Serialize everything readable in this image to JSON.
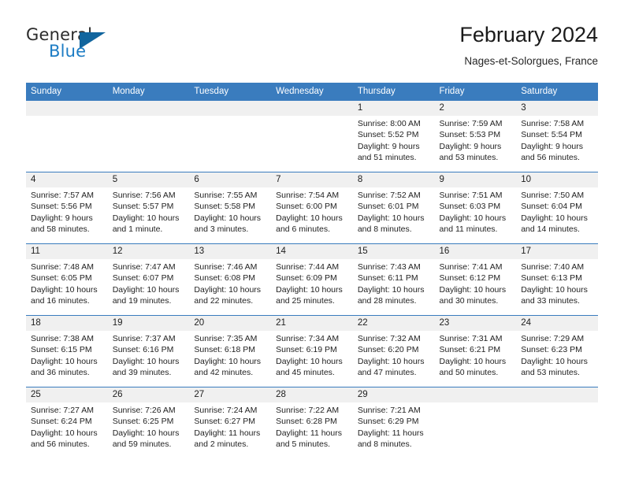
{
  "brand": {
    "name_top": "General",
    "name_bottom": "Blue",
    "triangle_color": "#11659e",
    "blue_text_color": "#1c7cc4"
  },
  "header": {
    "title": "February 2024",
    "subtitle": "Nages-et-Solorgues, France"
  },
  "theme": {
    "header_blue": "#3a7cbe",
    "daynum_band": "#f0f0f0",
    "text": "#1f1f1f"
  },
  "weekdays": [
    "Sunday",
    "Monday",
    "Tuesday",
    "Wednesday",
    "Thursday",
    "Friday",
    "Saturday"
  ],
  "weeks": [
    {
      "days": [
        {
          "num": "",
          "sunrise": "",
          "sunset": "",
          "daylight1": "",
          "daylight2": ""
        },
        {
          "num": "",
          "sunrise": "",
          "sunset": "",
          "daylight1": "",
          "daylight2": ""
        },
        {
          "num": "",
          "sunrise": "",
          "sunset": "",
          "daylight1": "",
          "daylight2": ""
        },
        {
          "num": "",
          "sunrise": "",
          "sunset": "",
          "daylight1": "",
          "daylight2": ""
        },
        {
          "num": "1",
          "sunrise": "Sunrise: 8:00 AM",
          "sunset": "Sunset: 5:52 PM",
          "daylight1": "Daylight: 9 hours",
          "daylight2": "and 51 minutes."
        },
        {
          "num": "2",
          "sunrise": "Sunrise: 7:59 AM",
          "sunset": "Sunset: 5:53 PM",
          "daylight1": "Daylight: 9 hours",
          "daylight2": "and 53 minutes."
        },
        {
          "num": "3",
          "sunrise": "Sunrise: 7:58 AM",
          "sunset": "Sunset: 5:54 PM",
          "daylight1": "Daylight: 9 hours",
          "daylight2": "and 56 minutes."
        }
      ]
    },
    {
      "days": [
        {
          "num": "4",
          "sunrise": "Sunrise: 7:57 AM",
          "sunset": "Sunset: 5:56 PM",
          "daylight1": "Daylight: 9 hours",
          "daylight2": "and 58 minutes."
        },
        {
          "num": "5",
          "sunrise": "Sunrise: 7:56 AM",
          "sunset": "Sunset: 5:57 PM",
          "daylight1": "Daylight: 10 hours",
          "daylight2": "and 1 minute."
        },
        {
          "num": "6",
          "sunrise": "Sunrise: 7:55 AM",
          "sunset": "Sunset: 5:58 PM",
          "daylight1": "Daylight: 10 hours",
          "daylight2": "and 3 minutes."
        },
        {
          "num": "7",
          "sunrise": "Sunrise: 7:54 AM",
          "sunset": "Sunset: 6:00 PM",
          "daylight1": "Daylight: 10 hours",
          "daylight2": "and 6 minutes."
        },
        {
          "num": "8",
          "sunrise": "Sunrise: 7:52 AM",
          "sunset": "Sunset: 6:01 PM",
          "daylight1": "Daylight: 10 hours",
          "daylight2": "and 8 minutes."
        },
        {
          "num": "9",
          "sunrise": "Sunrise: 7:51 AM",
          "sunset": "Sunset: 6:03 PM",
          "daylight1": "Daylight: 10 hours",
          "daylight2": "and 11 minutes."
        },
        {
          "num": "10",
          "sunrise": "Sunrise: 7:50 AM",
          "sunset": "Sunset: 6:04 PM",
          "daylight1": "Daylight: 10 hours",
          "daylight2": "and 14 minutes."
        }
      ]
    },
    {
      "days": [
        {
          "num": "11",
          "sunrise": "Sunrise: 7:48 AM",
          "sunset": "Sunset: 6:05 PM",
          "daylight1": "Daylight: 10 hours",
          "daylight2": "and 16 minutes."
        },
        {
          "num": "12",
          "sunrise": "Sunrise: 7:47 AM",
          "sunset": "Sunset: 6:07 PM",
          "daylight1": "Daylight: 10 hours",
          "daylight2": "and 19 minutes."
        },
        {
          "num": "13",
          "sunrise": "Sunrise: 7:46 AM",
          "sunset": "Sunset: 6:08 PM",
          "daylight1": "Daylight: 10 hours",
          "daylight2": "and 22 minutes."
        },
        {
          "num": "14",
          "sunrise": "Sunrise: 7:44 AM",
          "sunset": "Sunset: 6:09 PM",
          "daylight1": "Daylight: 10 hours",
          "daylight2": "and 25 minutes."
        },
        {
          "num": "15",
          "sunrise": "Sunrise: 7:43 AM",
          "sunset": "Sunset: 6:11 PM",
          "daylight1": "Daylight: 10 hours",
          "daylight2": "and 28 minutes."
        },
        {
          "num": "16",
          "sunrise": "Sunrise: 7:41 AM",
          "sunset": "Sunset: 6:12 PM",
          "daylight1": "Daylight: 10 hours",
          "daylight2": "and 30 minutes."
        },
        {
          "num": "17",
          "sunrise": "Sunrise: 7:40 AM",
          "sunset": "Sunset: 6:13 PM",
          "daylight1": "Daylight: 10 hours",
          "daylight2": "and 33 minutes."
        }
      ]
    },
    {
      "days": [
        {
          "num": "18",
          "sunrise": "Sunrise: 7:38 AM",
          "sunset": "Sunset: 6:15 PM",
          "daylight1": "Daylight: 10 hours",
          "daylight2": "and 36 minutes."
        },
        {
          "num": "19",
          "sunrise": "Sunrise: 7:37 AM",
          "sunset": "Sunset: 6:16 PM",
          "daylight1": "Daylight: 10 hours",
          "daylight2": "and 39 minutes."
        },
        {
          "num": "20",
          "sunrise": "Sunrise: 7:35 AM",
          "sunset": "Sunset: 6:18 PM",
          "daylight1": "Daylight: 10 hours",
          "daylight2": "and 42 minutes."
        },
        {
          "num": "21",
          "sunrise": "Sunrise: 7:34 AM",
          "sunset": "Sunset: 6:19 PM",
          "daylight1": "Daylight: 10 hours",
          "daylight2": "and 45 minutes."
        },
        {
          "num": "22",
          "sunrise": "Sunrise: 7:32 AM",
          "sunset": "Sunset: 6:20 PM",
          "daylight1": "Daylight: 10 hours",
          "daylight2": "and 47 minutes."
        },
        {
          "num": "23",
          "sunrise": "Sunrise: 7:31 AM",
          "sunset": "Sunset: 6:21 PM",
          "daylight1": "Daylight: 10 hours",
          "daylight2": "and 50 minutes."
        },
        {
          "num": "24",
          "sunrise": "Sunrise: 7:29 AM",
          "sunset": "Sunset: 6:23 PM",
          "daylight1": "Daylight: 10 hours",
          "daylight2": "and 53 minutes."
        }
      ]
    },
    {
      "days": [
        {
          "num": "25",
          "sunrise": "Sunrise: 7:27 AM",
          "sunset": "Sunset: 6:24 PM",
          "daylight1": "Daylight: 10 hours",
          "daylight2": "and 56 minutes."
        },
        {
          "num": "26",
          "sunrise": "Sunrise: 7:26 AM",
          "sunset": "Sunset: 6:25 PM",
          "daylight1": "Daylight: 10 hours",
          "daylight2": "and 59 minutes."
        },
        {
          "num": "27",
          "sunrise": "Sunrise: 7:24 AM",
          "sunset": "Sunset: 6:27 PM",
          "daylight1": "Daylight: 11 hours",
          "daylight2": "and 2 minutes."
        },
        {
          "num": "28",
          "sunrise": "Sunrise: 7:22 AM",
          "sunset": "Sunset: 6:28 PM",
          "daylight1": "Daylight: 11 hours",
          "daylight2": "and 5 minutes."
        },
        {
          "num": "29",
          "sunrise": "Sunrise: 7:21 AM",
          "sunset": "Sunset: 6:29 PM",
          "daylight1": "Daylight: 11 hours",
          "daylight2": "and 8 minutes."
        },
        {
          "num": "",
          "sunrise": "",
          "sunset": "",
          "daylight1": "",
          "daylight2": ""
        },
        {
          "num": "",
          "sunrise": "",
          "sunset": "",
          "daylight1": "",
          "daylight2": ""
        }
      ]
    }
  ]
}
